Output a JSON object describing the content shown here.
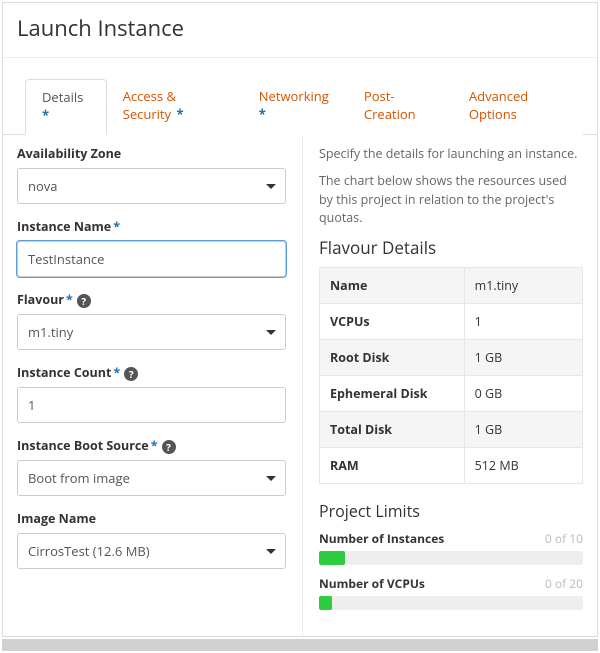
{
  "header": {
    "title": "Launch Instance"
  },
  "tabs": [
    {
      "label": "Details",
      "star": true,
      "active": true
    },
    {
      "label": "Access & Security",
      "star": true
    },
    {
      "label": "Networking",
      "star": true
    },
    {
      "label": "Post-Creation",
      "star": false
    },
    {
      "label": "Advanced Options",
      "star": false
    }
  ],
  "form": {
    "availability_zone": {
      "label": "Availability Zone",
      "value": "nova"
    },
    "instance_name": {
      "label": "Instance Name",
      "value": "TestInstance"
    },
    "flavour": {
      "label": "Flavour",
      "value": "m1.tiny"
    },
    "instance_count": {
      "label": "Instance Count",
      "value": "1"
    },
    "boot_source": {
      "label": "Instance Boot Source",
      "value": "Boot from image"
    },
    "image_name": {
      "label": "Image Name",
      "value": "CirrosTest (12.6 MB)"
    }
  },
  "info": {
    "line1": "Specify the details for launching an instance.",
    "line2": "The chart below shows the resources used by this project in relation to the project's quotas."
  },
  "flavour_details": {
    "title": "Flavour Details",
    "rows": [
      {
        "k": "Name",
        "v": "m1.tiny"
      },
      {
        "k": "VCPUs",
        "v": "1"
      },
      {
        "k": "Root Disk",
        "v": "1 GB"
      },
      {
        "k": "Ephemeral Disk",
        "v": "0 GB"
      },
      {
        "k": "Total Disk",
        "v": "1 GB"
      },
      {
        "k": "RAM",
        "v": "512 MB"
      }
    ]
  },
  "limits": {
    "title": "Project Limits",
    "items": [
      {
        "name": "Number of Instances",
        "text": "0 of 10",
        "pct": 10
      },
      {
        "name": "Number of VCPUs",
        "text": "0 of 20",
        "pct": 5
      }
    ]
  }
}
